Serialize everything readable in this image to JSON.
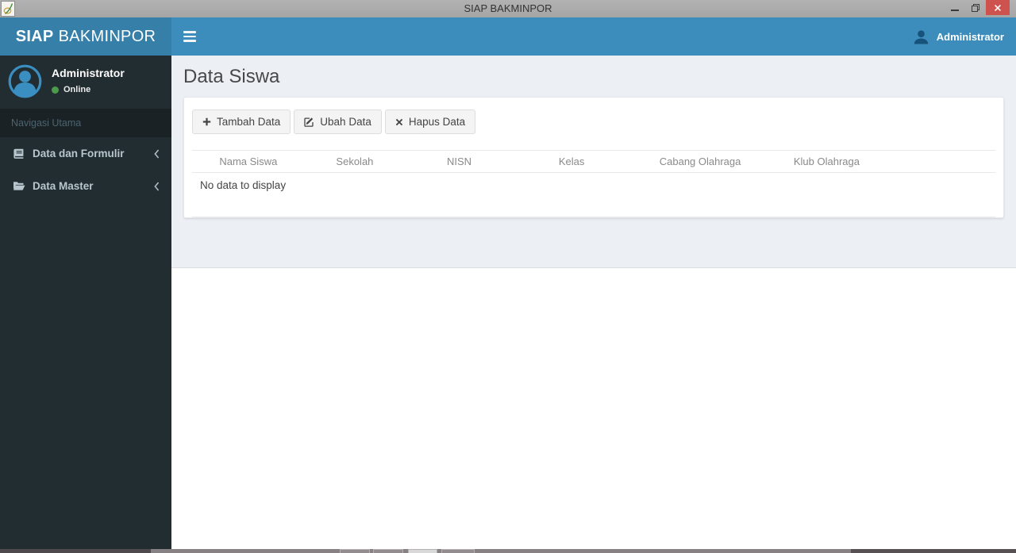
{
  "window": {
    "title": "SIAP BAKMINPOR"
  },
  "navbar": {
    "brand_bold": "SIAP",
    "brand_regular": "BAKMINPOR",
    "user_label": "Administrator"
  },
  "sidebar": {
    "user": {
      "name": "Administrator",
      "status": "Online"
    },
    "section_header": "Navigasi Utama",
    "items": [
      {
        "label": "Data dan Formulir",
        "icon": "book-icon"
      },
      {
        "label": "Data Master",
        "icon": "folder-open-icon"
      }
    ]
  },
  "main": {
    "page_title": "Data Siswa",
    "toolbar": [
      {
        "label": "Tambah Data",
        "icon": "plus-icon"
      },
      {
        "label": "Ubah Data",
        "icon": "edit-icon"
      },
      {
        "label": "Hapus Data",
        "icon": "times-icon"
      }
    ],
    "table": {
      "columns": [
        "Nama Siswa",
        "Sekolah",
        "NISN",
        "Kelas",
        "Cabang Olahraga",
        "Klub Olahraga"
      ],
      "empty_message": "No data to display"
    }
  },
  "colors": {
    "navbar_blue": "#3c8dbc",
    "logo_blue": "#367fa9",
    "sidebar_dark": "#222d32",
    "content_gray": "#ecf0f5",
    "close_red": "#ce524d",
    "online_green": "#4a9c4a"
  }
}
